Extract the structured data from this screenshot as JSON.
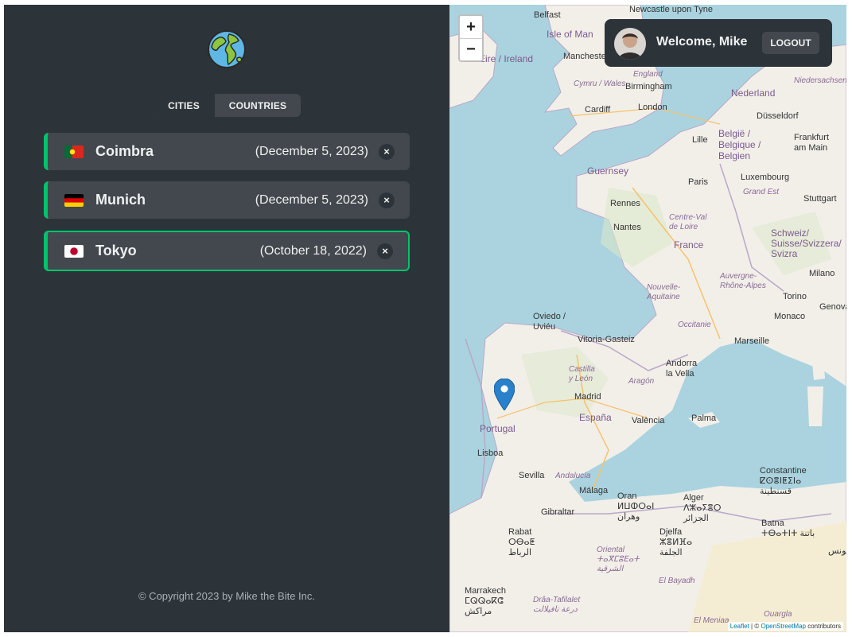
{
  "tabs": {
    "cities": "CITIES",
    "countries": "COUNTRIES"
  },
  "cities": [
    {
      "name": "Coimbra",
      "date": "(December 5, 2023)",
      "flag": "portugal-flag"
    },
    {
      "name": "Munich",
      "date": "(December 5, 2023)",
      "flag": "germany-flag"
    },
    {
      "name": "Tokyo",
      "date": "(October 18, 2022)",
      "flag": "japan-flag"
    }
  ],
  "delete_symbol": "×",
  "copyright": "© Copyright 2023 by Mike the Bite Inc.",
  "user": {
    "welcome": "Welcome, Mike",
    "logout": "LOGOUT"
  },
  "map": {
    "zoom_in": "+",
    "zoom_out": "−",
    "labels": {
      "newcastle": "Newcastle upon Tyne",
      "belfast": "Belfast",
      "isle_of_man": "Isle of Man",
      "ireland": "Éire / Ireland",
      "manchester": "Manchester",
      "england": "England",
      "cymru": "Cymru / Wales",
      "birmingham": "Birmingham",
      "cardiff": "Cardiff",
      "london": "London",
      "nederland": "Nederland",
      "niedersachsen": "Niedersachsen",
      "dusseldorf": "Düsseldorf",
      "belgie": "België / Belgique / Belgien",
      "lille": "Lille",
      "frankfurt": "Frankfurt am Main",
      "guernsey": "Guernsey",
      "luxembourg": "Luxembourg",
      "paris": "Paris",
      "grand_est": "Grand Est",
      "stuttgart": "Stuttgart",
      "rennes": "Rennes",
      "centre": "Centre-Val de Loire",
      "nantes": "Nantes",
      "france": "France",
      "schweiz": "Schweiz/ Suisse/Svizzera/ Svizra",
      "nouvelle": "Nouvelle-Aquitaine",
      "auvergne": "Auvergne-Rhône-Alpes",
      "milano": "Milano",
      "torino": "Torino",
      "genova": "Genova",
      "oviedo": "Oviedo / Uviéu",
      "occitanie": "Occitanie",
      "monaco": "Monaco",
      "marseille": "Marseille",
      "vitoria": "Vitoria-Gasteiz",
      "andorra": "Andorra la Vella",
      "castilla": "Castilla y León",
      "aragon": "Aragón",
      "madrid": "Madrid",
      "espana": "España",
      "valencia": "València",
      "palma": "Palma",
      "portugal": "Portugal",
      "lisboa": "Lisboa",
      "sevilla": "Sevilla",
      "andalucia": "Andalucía",
      "malaga": "Málaga",
      "gibraltar": "Gibraltar",
      "oran": "Oran ⵍⵡⵀⵔⴰⵏ وهران",
      "alger": "Alger ⴷⵣⴰⵢⴻⵔ الجزائر",
      "constantine": "Constantine ⵇⵙⴻⵏⵟⵉⵏⴰ قسنطينة",
      "batna": "Batna ⵜⴱⴰⵜⵏⵜ باتنة",
      "djelfa": "Djelfa ⵣⴻⵍⴼⴰ الجلفة",
      "rabat": "Rabat ⵔⴱⴰⵟ الرباط",
      "oriental": "Oriental ⵜⴰⴳⵎⵓⴹⴰⵜ الشرقية",
      "el_bayadh": "El Bayadh",
      "marrakech": "Marrakech ⵎⵕⵕⴰⴽⵛ مراكش",
      "draa": "Drâa-Tafilalet درعة تافيلالت",
      "el_meniaa": "El Meniaa",
      "ouargla": "Ouargla",
      "tunis": "تونس"
    },
    "attribution_leaflet": "Leaflet",
    "attribution_sep": "| ©",
    "attribution_osm": "OpenStreetMap",
    "attribution_tail": "contributors"
  },
  "colors": {
    "accent": "#00c46a",
    "sidebar": "#2d3439",
    "card": "#42484d",
    "text": "#eef0f1",
    "sea": "#aad3df",
    "land": "#f2efe9"
  }
}
